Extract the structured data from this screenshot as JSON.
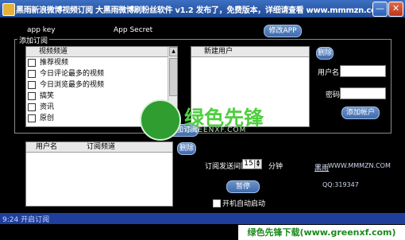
{
  "window": {
    "title": "黑雨新浪微博视频订阅 大黑雨微博刷粉丝软件 v1.2 发布了，免费版本，详细请查看 www.mmmzn.com",
    "minimize_glyph": "—",
    "close_glyph": "✕"
  },
  "app": {
    "key_label": "app key",
    "secret_label": "App Secret",
    "modify_button": "修改APP"
  },
  "subscribe": {
    "group_label": "添加订阅",
    "category_header": "视频频道",
    "categories": [
      {
        "label": "推荐视频",
        "checked": false
      },
      {
        "label": "今日评论最多的视频",
        "checked": false
      },
      {
        "label": "今日浏览最多的视频",
        "checked": false
      },
      {
        "label": "搞笑",
        "checked": false
      },
      {
        "label": "资讯",
        "checked": false
      },
      {
        "label": "原创",
        "checked": false
      }
    ],
    "new_user_header": "新建用户",
    "delete_button": "删除",
    "username_label": "用户名",
    "password_label": "密码",
    "add_account_button": "添加帐户",
    "add_subscription_button": "添加订阅"
  },
  "subscriptions_table": {
    "headers": [
      "用户名",
      "订阅频道"
    ],
    "delete_button": "删除"
  },
  "interval": {
    "label": "订阅发送间隔",
    "value": "15",
    "unit": "分钟"
  },
  "control": {
    "pause_button": "暂停",
    "autostart_label": "开机自动启动",
    "autostart_checked": false
  },
  "site": {
    "name": "黑雨",
    "url": "WWW.MMMZN.COM",
    "qq": "QQ:319347"
  },
  "status": {
    "text": "9:24  开启订阅"
  },
  "footer": {
    "brand": "绿色先锋下载(www.greenxf.com)"
  },
  "watermark": {
    "text": "绿色先锋",
    "sub": "GREENXF.COM"
  },
  "colors": {
    "titlebar": "#2a5aa8",
    "statusbar": "#1f3f9c",
    "watermark_green": "#4fcf3f",
    "background": "#000000"
  }
}
